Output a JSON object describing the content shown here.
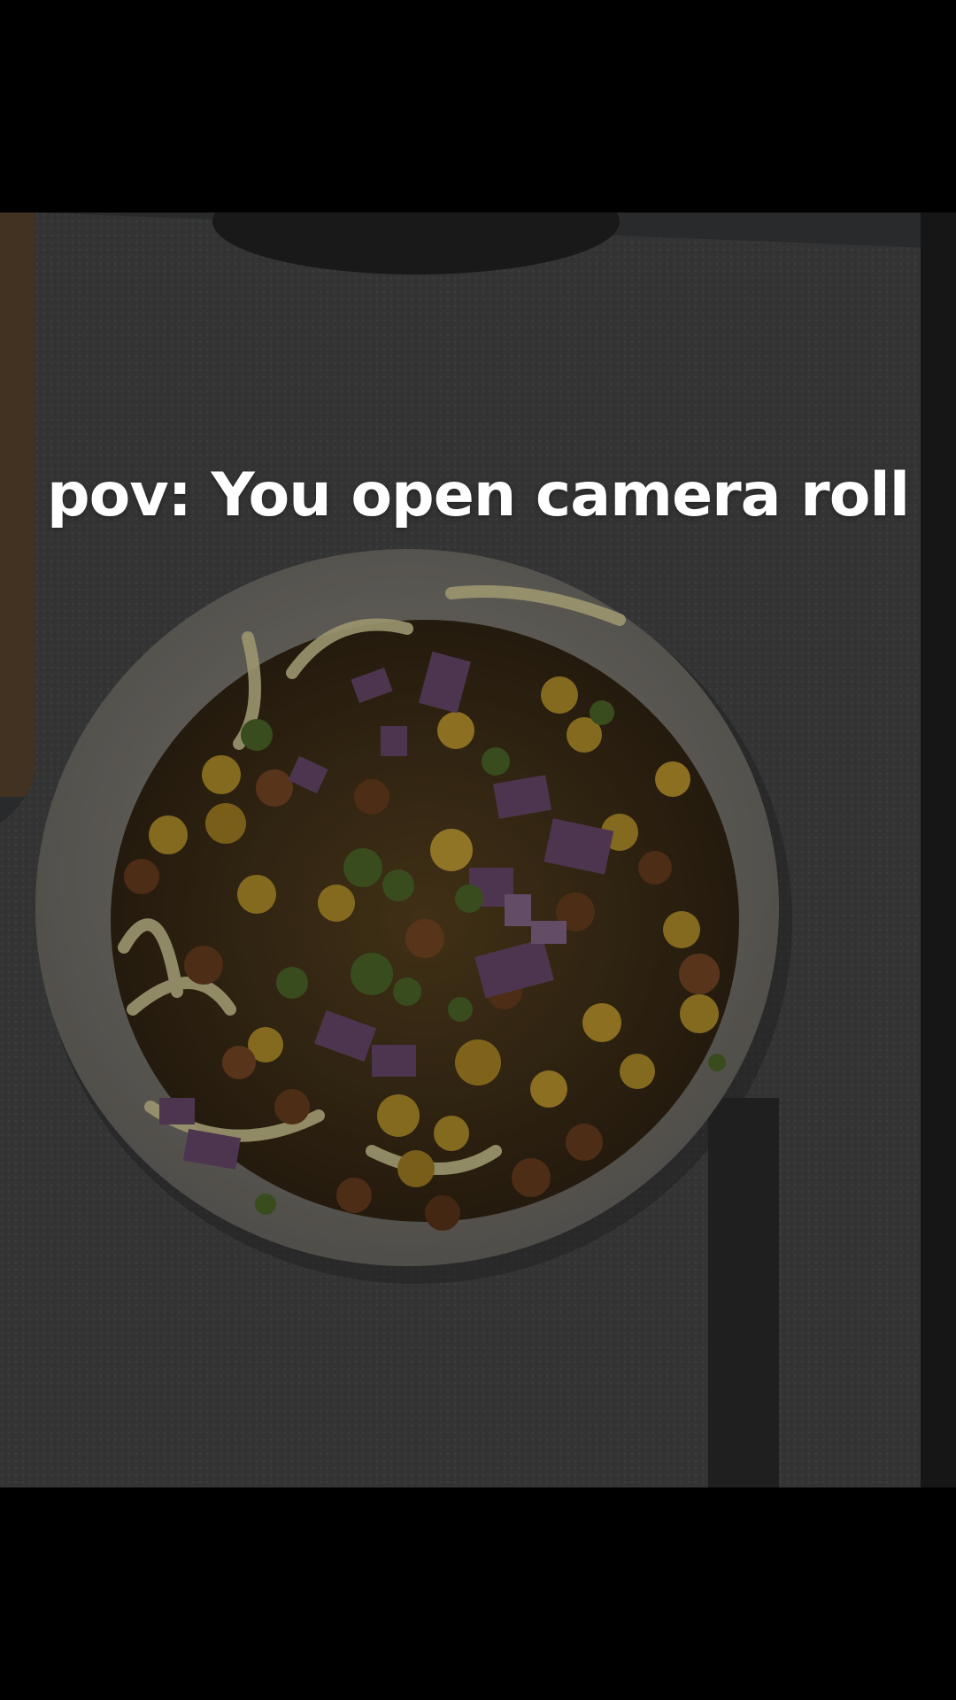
{
  "caption": {
    "text": "pov: You open camera roll"
  },
  "photo": {
    "subject": "bowl-of-chickpea-pasta",
    "colors": {
      "towel": "#4a4b4c",
      "bowl": "#8d8a83",
      "chickpea": "#b8942b",
      "roasted_chickpea": "#6b3f1f",
      "onion": "#6d4a6e",
      "herbs": "#4f6a2a",
      "pasta": "#d8cf9a"
    }
  }
}
